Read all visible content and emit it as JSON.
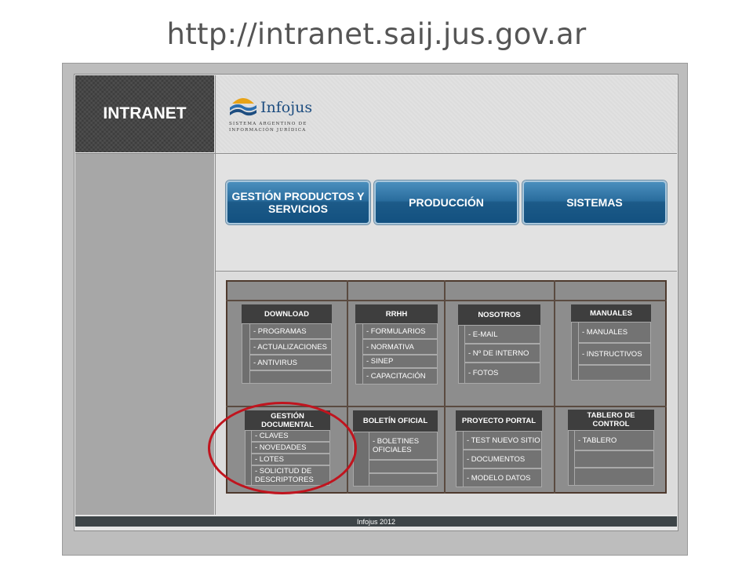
{
  "slide_title": "http://intranet.saij.jus.gov.ar",
  "header": {
    "intranet_label": "INTRANET",
    "logo_name": "Infojus",
    "logo_subtitle": "SISTEMA ARGENTINO DE INFORMACIÓN JURÍDICA"
  },
  "nav": {
    "gestion": "GESTIÓN PRODUCTOS Y SERVICIOS",
    "produccion": "PRODUCCIÓN",
    "sistemas": "SISTEMAS"
  },
  "menus": {
    "download": {
      "title": "DOWNLOAD",
      "items": [
        "- PROGRAMAS",
        "- ACTUALIZACIONES",
        "- ANTIVIRUS"
      ]
    },
    "rrhh": {
      "title": "RRHH",
      "items": [
        "- FORMULARIOS",
        "- NORMATIVA",
        "- SINEP",
        "- CAPACITACIÓN"
      ]
    },
    "nosotros": {
      "title": "NOSOTROS",
      "items": [
        "- E-MAIL",
        "- Nº DE INTERNO",
        "- FOTOS"
      ]
    },
    "manuales": {
      "title": "MANUALES",
      "items": [
        "- MANUALES",
        "- INSTRUCTIVOS"
      ]
    },
    "gestion_documental": {
      "title": "GESTIÓN DOCUMENTAL",
      "items": [
        "- CLAVES",
        "- NOVEDADES",
        "- LOTES",
        "- SOLICITUD DE DESCRIPTORES"
      ]
    },
    "boletin_oficial": {
      "title": "BOLETÍN OFICIAL",
      "items": [
        "- BOLETINES OFICIALES"
      ]
    },
    "proyecto_portal": {
      "title": "PROYECTO PORTAL",
      "items": [
        "- TEST NUEVO SITIO",
        "- DOCUMENTOS",
        "- MODELO DATOS"
      ]
    },
    "tablero_control": {
      "title": "TABLERO DE CONTROL",
      "items": [
        "- TABLERO"
      ]
    }
  },
  "footer": {
    "text": "Infojus 2012"
  },
  "colors": {
    "nav_button": "#1c5a88",
    "menu_header": "#3e3e3e",
    "highlight_circle": "#c0141e",
    "footer_bar": "#3d4447"
  },
  "icons": {
    "logo": "infojus-sun-wave-logo"
  }
}
